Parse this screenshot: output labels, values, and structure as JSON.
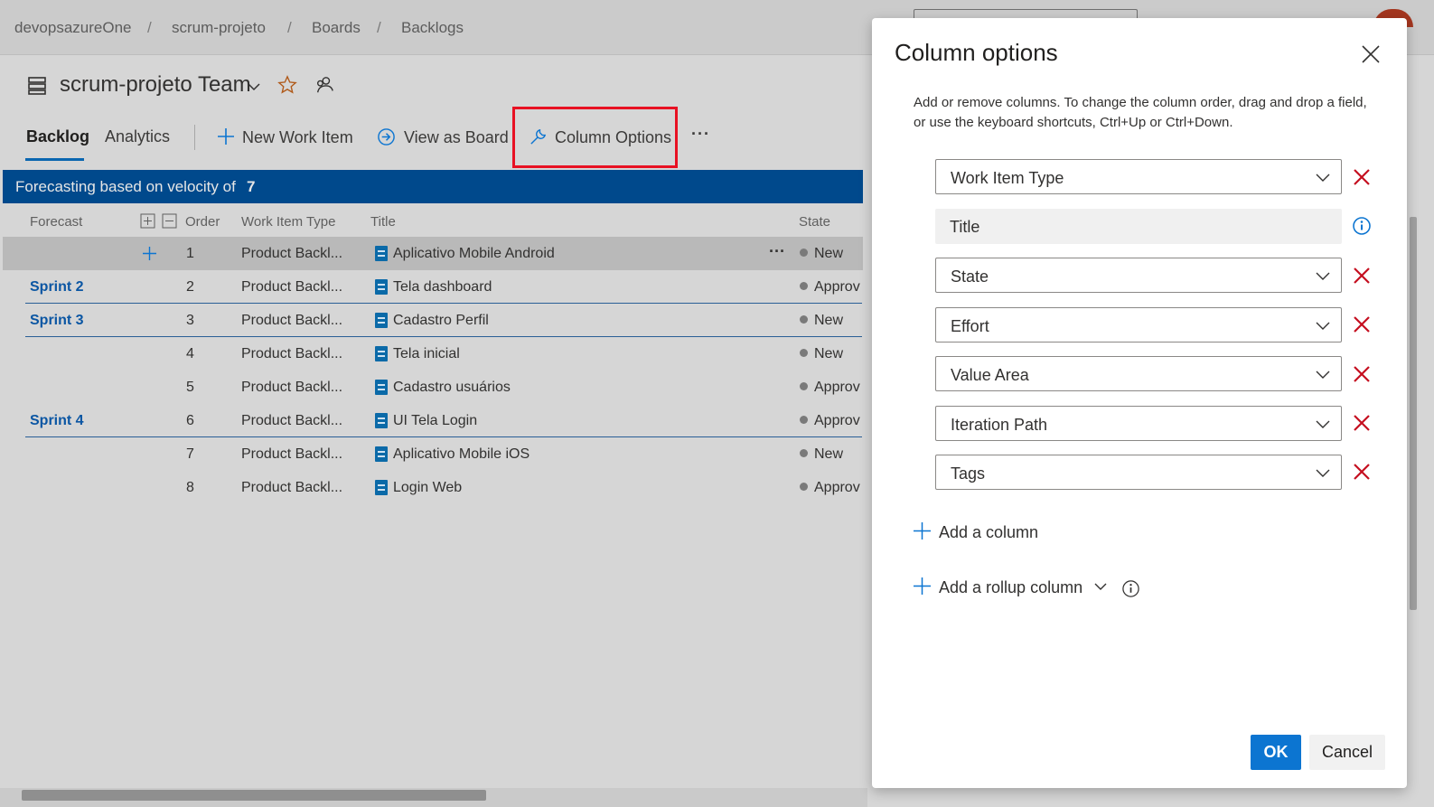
{
  "breadcrumb": [
    "devopsazureOne",
    "scrum-projeto",
    "Boards",
    "Backlogs"
  ],
  "team": {
    "name": "scrum-projeto Team"
  },
  "tabs": {
    "backlog": "Backlog",
    "analytics": "Analytics"
  },
  "toolbar": {
    "new_work_item": "New Work Item",
    "view_as_board": "View as Board",
    "column_options": "Column Options",
    "more": "···"
  },
  "banner": {
    "text": "Forecasting based on velocity of",
    "velocity": "7"
  },
  "grid": {
    "headers": {
      "forecast": "Forecast",
      "order": "Order",
      "type": "Work Item Type",
      "title": "Title",
      "state": "State"
    },
    "rows": [
      {
        "sprint": "",
        "order": "1",
        "type": "Product Backl...",
        "title": "Aplicativo Mobile Android",
        "state": "New"
      },
      {
        "sprint": "Sprint 2",
        "order": "2",
        "type": "Product Backl...",
        "title": "Tela dashboard",
        "state": "Approv"
      },
      {
        "sprint": "Sprint 3",
        "order": "3",
        "type": "Product Backl...",
        "title": "Cadastro Perfil",
        "state": "New"
      },
      {
        "sprint": "",
        "order": "4",
        "type": "Product Backl...",
        "title": "Tela inicial",
        "state": "New"
      },
      {
        "sprint": "",
        "order": "5",
        "type": "Product Backl...",
        "title": "Cadastro usuários",
        "state": "Approv"
      },
      {
        "sprint": "Sprint 4",
        "order": "6",
        "type": "Product Backl...",
        "title": "UI Tela Login",
        "state": "Approv"
      },
      {
        "sprint": "",
        "order": "7",
        "type": "Product Backl...",
        "title": "Aplicativo Mobile iOS",
        "state": "New"
      },
      {
        "sprint": "",
        "order": "8",
        "type": "Product Backl...",
        "title": "Login Web",
        "state": "Approv"
      }
    ]
  },
  "panel": {
    "title": "Column options",
    "description": "Add or remove columns. To change the column order, drag and drop a field, or use the keyboard shortcuts, Ctrl+Up or Ctrl+Down.",
    "columns": [
      "Work Item Type",
      "Title",
      "State",
      "Effort",
      "Value Area",
      "Iteration Path",
      "Tags"
    ],
    "add_column": "Add a column",
    "add_rollup": "Add a rollup column",
    "ok": "OK",
    "cancel": "Cancel"
  },
  "colors": {
    "accent": "#0c75d1",
    "remove": "#c50f1f",
    "banner": "#00498c",
    "highlight": "#e81123"
  }
}
